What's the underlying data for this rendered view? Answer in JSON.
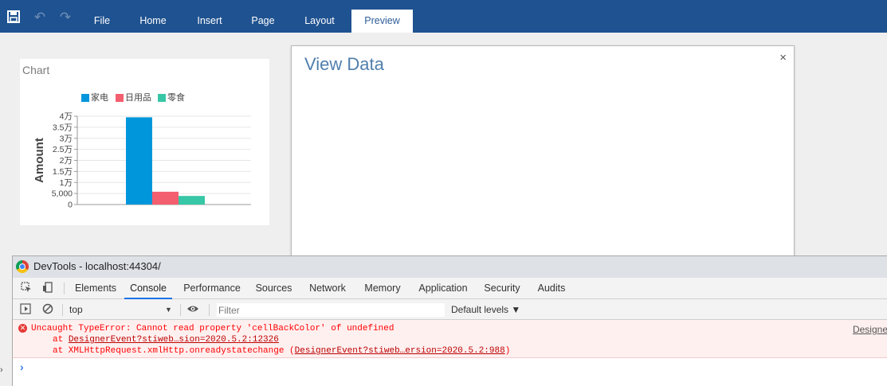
{
  "topbar": {
    "save_icon": "save-icon",
    "undo_icon": "undo-icon",
    "redo_icon": "redo-icon",
    "tabs": [
      "File",
      "Home",
      "Insert",
      "Page",
      "Layout",
      "Preview"
    ],
    "active_tab": "Preview",
    "bg_color": "#1f5290"
  },
  "chart_card": {
    "title": "Chart"
  },
  "chart_data": {
    "type": "bar",
    "title": "Chart",
    "ylabel": "Amount",
    "xlabel": "",
    "ylim": [
      0,
      40000
    ],
    "yticks": [
      0,
      5000,
      10000,
      15000,
      20000,
      25000,
      30000,
      35000,
      40000
    ],
    "ytick_labels": [
      "0",
      "5,000",
      "1万",
      "1.5万",
      "2万",
      "2.5万",
      "3万",
      "3.5万",
      "4万"
    ],
    "legend_position": "top",
    "grid": true,
    "categories": [
      ""
    ],
    "series": [
      {
        "name": "家电",
        "values": [
          39500
        ],
        "color": "#0096dc"
      },
      {
        "name": "日用品",
        "values": [
          5800
        ],
        "color": "#f35f6e"
      },
      {
        "name": "零食",
        "values": [
          3900
        ],
        "color": "#38c7a6"
      }
    ]
  },
  "dialog": {
    "title": "View Data",
    "close_glyph": "×"
  },
  "devtools": {
    "title": "DevTools - localhost:44304/",
    "tabs": [
      "Elements",
      "Console",
      "Performance",
      "Sources",
      "Network",
      "Memory",
      "Application",
      "Security",
      "Audits"
    ],
    "active_tab": "Console",
    "context": "top",
    "filter_placeholder": "Filter",
    "levels": "Default levels ▼",
    "error": {
      "message": "Uncaught TypeError: Cannot read property 'cellBackColor' of undefined",
      "stack1_prefix": "at ",
      "stack1_link": "DesignerEvent?stiweb…sion=2020.5.2:12326",
      "stack2_prefix": "at XMLHttpRequest.xmlHttp.onreadystatechange (",
      "stack2_link": "DesignerEvent?stiweb…ersion=2020.5.2:988",
      "stack2_suffix": ")",
      "source": "Designe"
    },
    "prompt": "›"
  }
}
